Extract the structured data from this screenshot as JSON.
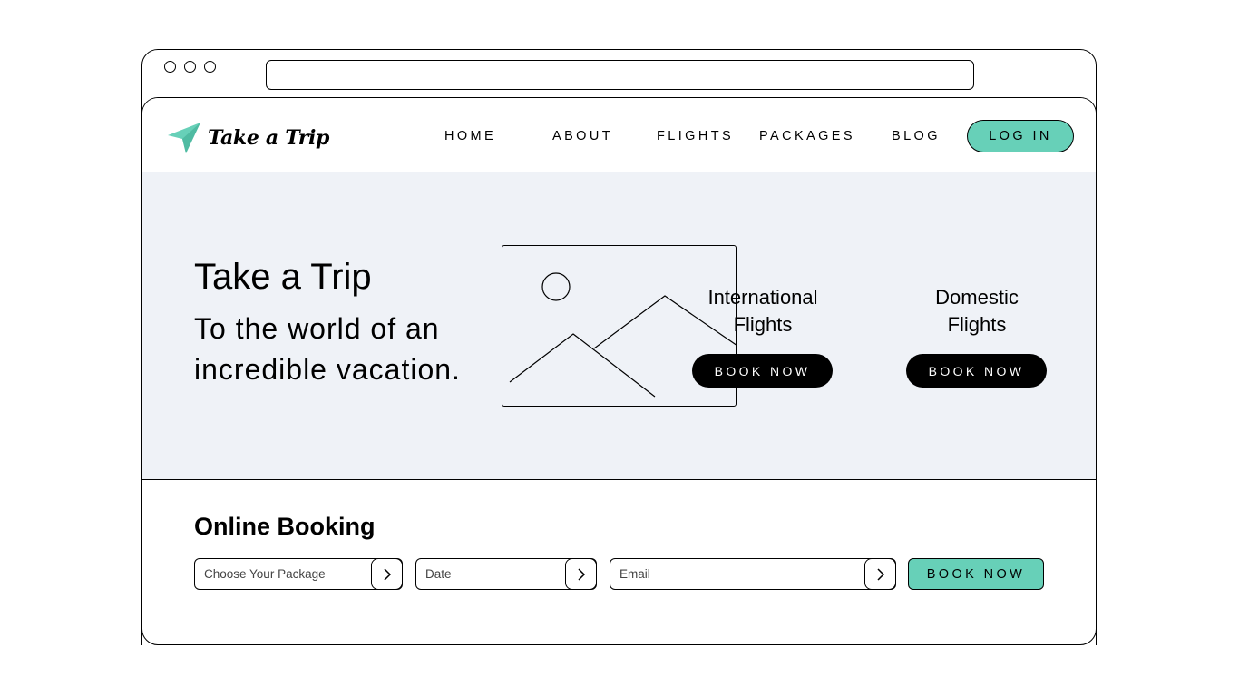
{
  "brand": {
    "name": "Take a Trip",
    "accent_color": "#67d0b8",
    "logo_icon": "paper-plane-icon"
  },
  "nav": {
    "links": [
      "HOME",
      "ABOUT",
      "FLIGHTS",
      "PACKAGES",
      "BLOG"
    ],
    "login_label": "LOG IN"
  },
  "hero": {
    "title": "Take a Trip",
    "subtitle": "To the world of an incredible vacation.",
    "image_icon": "image-placeholder-icon",
    "background_color": "#eff2f7",
    "cards": [
      {
        "title": "International\nFlights",
        "button": "BOOK NOW"
      },
      {
        "title": "Domestic\nFlights",
        "button": "BOOK NOW"
      }
    ]
  },
  "booking": {
    "title": "Online Booking",
    "package_placeholder": "Choose Your Package",
    "date_placeholder": "Date",
    "email_placeholder": "Email",
    "button": "BOOK NOW"
  }
}
